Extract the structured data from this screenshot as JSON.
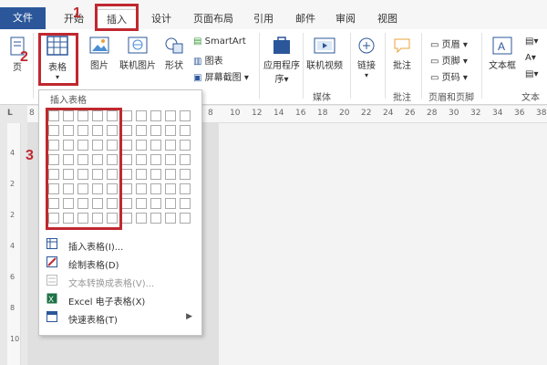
{
  "tabs": {
    "file": "文件",
    "home": "开始",
    "insert": "插入",
    "design": "设计",
    "layout": "页面布局",
    "references": "引用",
    "mailings": "邮件",
    "review": "审阅",
    "view": "视图"
  },
  "ribbon": {
    "pages": "页",
    "table": "表格",
    "picture": "图片",
    "online_picture": "联机图片",
    "shapes": "形状",
    "smartart": "SmartArt",
    "chart": "图表",
    "screenshot": "屏幕截图",
    "apps": "应用程序",
    "apps_line2": "序",
    "online_video": "联机视频",
    "media_group": "媒体",
    "link": "链接",
    "comment": "批注",
    "comment_group": "批注",
    "header": "页眉",
    "footer": "页脚",
    "page_number": "页码",
    "header_footer_group": "页眉和页脚",
    "textbox": "文本框",
    "text_group": "文本"
  },
  "dropdown": {
    "title": "插入表格",
    "items": [
      {
        "label": "插入表格(I)..."
      },
      {
        "label": "绘制表格(D)"
      },
      {
        "label": "文本转换成表格(V)..."
      },
      {
        "label": "Excel 电子表格(X)"
      },
      {
        "label": "快速表格(T)"
      }
    ]
  },
  "ruler": {
    "left_marker": "L",
    "start": "8",
    "ticks": [
      "8",
      "10",
      "12",
      "14",
      "16",
      "18",
      "20",
      "22",
      "24",
      "26",
      "28",
      "30",
      "32",
      "34",
      "36",
      "38"
    ],
    "vticks": [
      "4",
      "2",
      "2",
      "4",
      "6",
      "8",
      "10"
    ]
  },
  "annotations": {
    "step1": "1",
    "step2": "2",
    "step3": "3"
  },
  "colors": {
    "accent": "#2b579a",
    "highlight": "#c0282f"
  }
}
